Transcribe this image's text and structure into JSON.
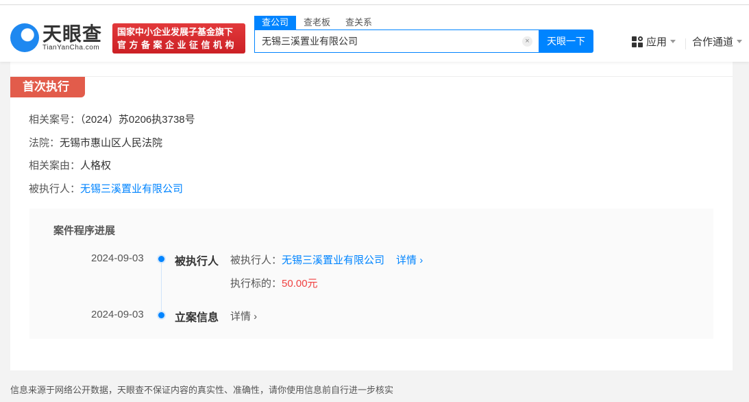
{
  "header": {
    "logo_cn": "天眼查",
    "logo_en": "TianYanCha.com",
    "slogan_line1": "国家中小企业发展子基金旗下",
    "slogan_line2": "官方备案企业征信机构",
    "tabs": [
      "查公司",
      "查老板",
      "查关系"
    ],
    "search_value": "无锡三溪置业有限公司",
    "search_button": "天眼一下",
    "apps_label": "应用",
    "partner_label": "合作通道"
  },
  "card": {
    "badge": "首次执行",
    "fields": [
      {
        "label": "相关案号：",
        "value": "（2024）苏0206执3738号"
      },
      {
        "label": "法院：",
        "value": "无锡市惠山区人民法院"
      },
      {
        "label": "相关案由：",
        "value": "人格权"
      },
      {
        "label": "被执行人：",
        "value": "无锡三溪置业有限公司"
      }
    ],
    "progress": {
      "title": "案件程序进展",
      "events": [
        {
          "date": "2024-09-03",
          "name": "被执行人",
          "detail_label": "被执行人：",
          "detail_value": "无锡三溪置业有限公司",
          "link": "详情",
          "amount_label": "执行标的：",
          "amount": "50.00元"
        },
        {
          "date": "2024-09-03",
          "name": "立案信息",
          "link": "详情"
        }
      ]
    }
  },
  "footer": "信息来源于网络公开数据，天眼查不保证内容的真实性、准确性，请你使用信息前自行进一步核实",
  "colors": {
    "brand": "#0084ff",
    "badge": "#e25c4b",
    "amount": "#f04040"
  }
}
